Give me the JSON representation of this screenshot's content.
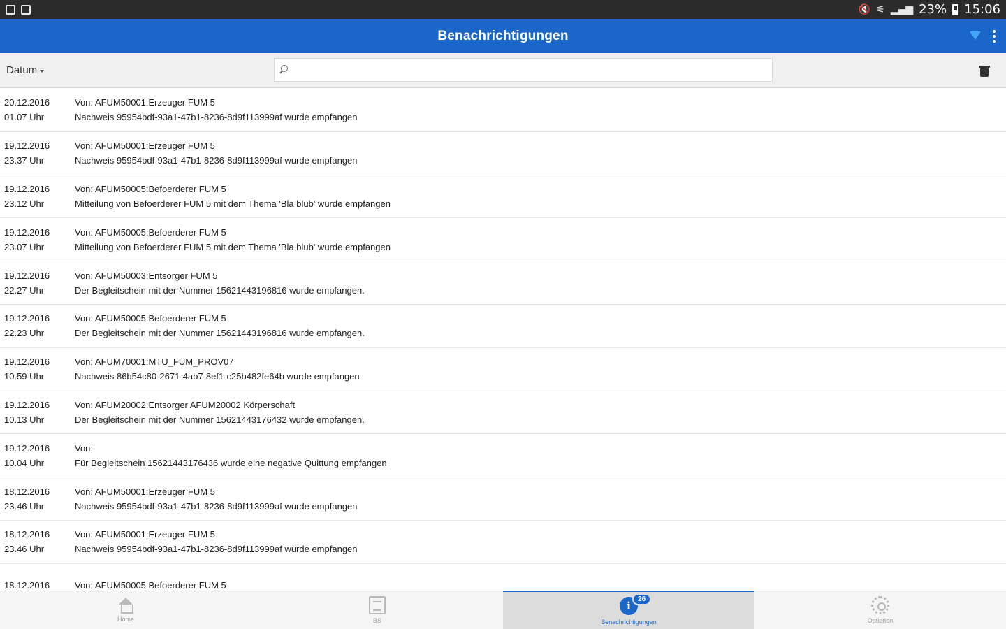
{
  "status_bar": {
    "battery": "23%",
    "time": "15:06"
  },
  "header": {
    "title": "Benachrichtigungen"
  },
  "toolbar": {
    "sort_label": "Datum",
    "search_placeholder": ""
  },
  "notifications": [
    {
      "date": "20.12.2016",
      "time": "01.07 Uhr",
      "from": "Von: AFUM50001:Erzeuger FUM 5",
      "message": "Nachweis 95954bdf-93a1-47b1-8236-8d9f113999af wurde empfangen"
    },
    {
      "date": "19.12.2016",
      "time": "23.37 Uhr",
      "from": "Von: AFUM50001:Erzeuger FUM 5",
      "message": "Nachweis 95954bdf-93a1-47b1-8236-8d9f113999af wurde empfangen"
    },
    {
      "date": "19.12.2016",
      "time": "23.12 Uhr",
      "from": "Von: AFUM50005:Befoerderer FUM 5",
      "message": "Mitteilung von Befoerderer FUM 5 mit dem Thema 'Bla blub' wurde empfangen"
    },
    {
      "date": "19.12.2016",
      "time": "23.07 Uhr",
      "from": "Von: AFUM50005:Befoerderer FUM 5",
      "message": "Mitteilung von Befoerderer FUM 5 mit dem Thema 'Bla blub' wurde empfangen"
    },
    {
      "date": "19.12.2016",
      "time": "22.27 Uhr",
      "from": "Von: AFUM50003:Entsorger FUM 5",
      "message": "Der Begleitschein mit der Nummer 15621443196816 wurde empfangen."
    },
    {
      "date": "19.12.2016",
      "time": "22.23 Uhr",
      "from": "Von: AFUM50005:Befoerderer FUM 5",
      "message": "Der Begleitschein mit der Nummer 15621443196816 wurde empfangen."
    },
    {
      "date": "19.12.2016",
      "time": "10.59 Uhr",
      "from": "Von: AFUM70001:MTU_FUM_PROV07",
      "message": "Nachweis 86b54c80-2671-4ab7-8ef1-c25b482fe64b wurde empfangen"
    },
    {
      "date": "19.12.2016",
      "time": "10.13 Uhr",
      "from": "Von: AFUM20002:Entsorger AFUM20002 Körperschaft",
      "message": "Der Begleitschein mit der Nummer 15621443176432 wurde empfangen."
    },
    {
      "date": "19.12.2016",
      "time": "10.04 Uhr",
      "from": "Von:",
      "message": "Für Begleitschein 15621443176436 wurde eine negative Quittung empfangen"
    },
    {
      "date": "18.12.2016",
      "time": "23.46 Uhr",
      "from": "Von: AFUM50001:Erzeuger FUM 5",
      "message": "Nachweis 95954bdf-93a1-47b1-8236-8d9f113999af wurde empfangen"
    },
    {
      "date": "18.12.2016",
      "time": "23.46 Uhr",
      "from": "Von: AFUM50001:Erzeuger FUM 5",
      "message": "Nachweis 95954bdf-93a1-47b1-8236-8d9f113999af wurde empfangen"
    },
    {
      "date": "18.12.2016",
      "time": "",
      "from": "Von: AFUM50005:Befoerderer FUM 5",
      "message": ""
    }
  ],
  "bottom_nav": {
    "home": "Home",
    "docs": "BS",
    "notifications": "Benachrichtigungen",
    "notifications_badge": "26",
    "options": "Optionen"
  }
}
